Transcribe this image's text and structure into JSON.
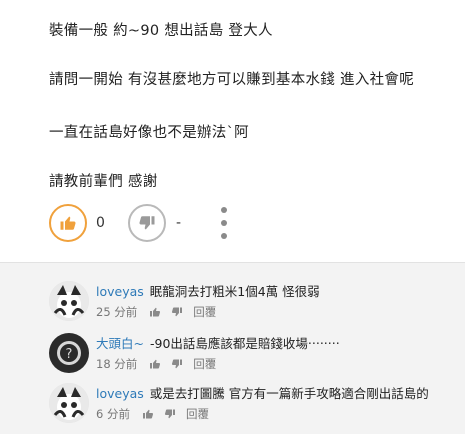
{
  "post": {
    "lines": [
      "裝備一般 約~90  想出話島 登大人",
      "請問一開始 有沒甚麼地方可以賺到基本水錢  進入社會呢",
      "一直在話島好像也不是辦法`阿",
      "請教前輩們 感謝"
    ],
    "like_count": "0",
    "dislike_count": "-"
  },
  "comments": [
    {
      "author": "loveyas",
      "text": "眠龍洞去打粗米1個4萬 怪很弱",
      "time": "25 分前",
      "reply": "回覆"
    },
    {
      "author": "大頭白~",
      "text": "-90出話島應該都是賠錢收場‧‧‧‧‧‧‧‧",
      "time": "18 分前",
      "reply": "回覆"
    },
    {
      "author": "loveyas",
      "text": "或是去打圖騰 官方有一篇新手攻略適合剛出話島的",
      "time": "6 分前",
      "reply": "回覆"
    }
  ],
  "colors": {
    "like_accent": "#f0a13c",
    "author_link": "#2e7ab8",
    "comment_bg": "#f3f3f3"
  }
}
